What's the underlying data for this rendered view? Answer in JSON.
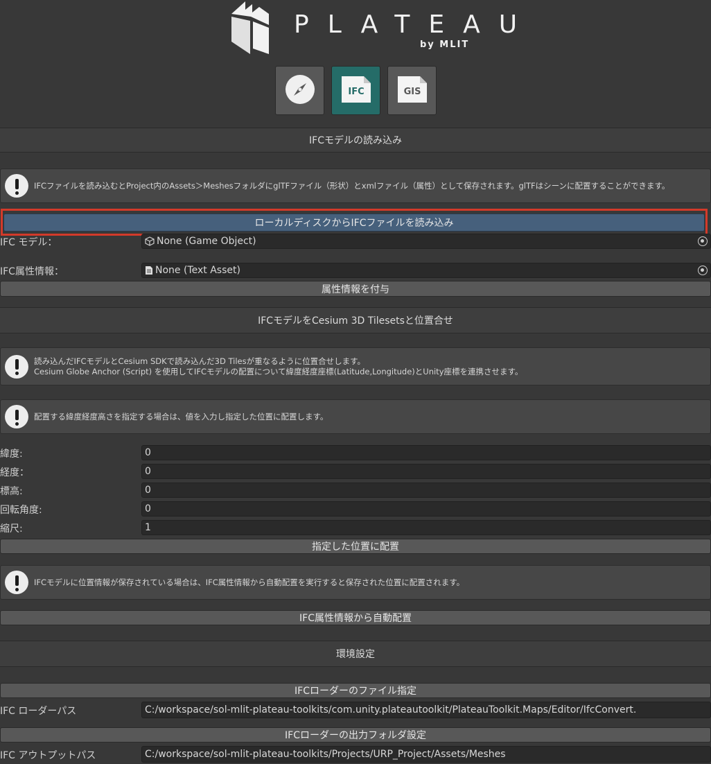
{
  "header": {
    "logo_text": "PLATEAU",
    "logo_sub": "by MLIT",
    "tool_buttons": [
      {
        "name": "compass",
        "label": ""
      },
      {
        "name": "ifc",
        "label": "IFC"
      },
      {
        "name": "gis",
        "label": "GIS"
      }
    ],
    "active_tool": "IFC"
  },
  "ifc_load": {
    "title": "IFCモデルの読み込み",
    "help": "IFCファイルを読み込むとProject内のAssets＞MeshesフォルダにglTFファイル（形状）とxmlファイル（属性）として保存されます。glTFはシーンに配置することができます。",
    "load_button": "ローカルディスクからIFCファイルを読み込み",
    "model_label": "IFC モデル：",
    "model_value": "None (Game Object)",
    "attr_label": "IFC属性情報：",
    "attr_value": "None (Text Asset)",
    "attach_button": "属性情報を付与"
  },
  "align": {
    "title": "IFCモデルをCesium 3D Tilesetsと位置合せ",
    "help1_line1": "読み込んだIFCモデルとCesium SDKで読み込んだ3D Tilesが重なるように位置合せします。",
    "help1_line2": "Cesium Globe Anchor (Script) を使用してIFCモデルの配置について緯度経度座標(Latitude,Longitude)とUnity座標を連携させます。",
    "help2": "配置する緯度経度高さを指定する場合は、値を入力し指定した位置に配置します。",
    "fields": [
      {
        "label": "緯度:",
        "value": "0"
      },
      {
        "label": "経度：",
        "value": "0"
      },
      {
        "label": "標高:",
        "value": "0"
      },
      {
        "label": "回転角度:",
        "value": "0"
      },
      {
        "label": "縮尺:",
        "value": "1"
      }
    ],
    "place_button": "指定した位置に配置",
    "help3": "IFCモデルに位置情報が保存されている場合は、IFC属性情報から自動配置を実行すると保存された位置に配置されます。",
    "auto_button": "IFC属性情報から自動配置"
  },
  "env": {
    "title": "環境設定",
    "loader_file_button": "IFCローダーのファイル指定",
    "loader_path_label": "IFC ローダーパス",
    "loader_path_value": "C:/workspace/sol-mlit-plateau-toolkits/com.unity.plateautoolkit/PlateauToolkit.Maps/Editor/IfcConvert.",
    "output_folder_button": "IFCローダーの出力フォルダ設定",
    "output_path_label": "IFC アウトプットパス",
    "output_path_value": "C:/workspace/sol-mlit-plateau-toolkits/Projects/URP_Project/Assets/Meshes"
  },
  "colors": {
    "background": "#383838",
    "active_tool": "#256c68",
    "primary_button": "#46607c",
    "highlight": "#d33a2a"
  }
}
